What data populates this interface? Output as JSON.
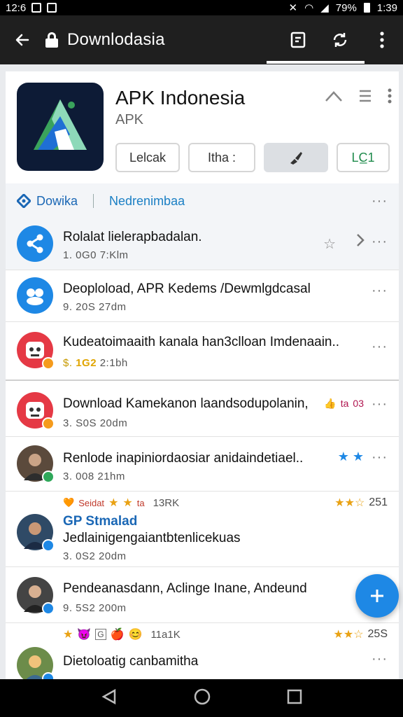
{
  "status_bar": {
    "time_left": "12:6",
    "battery": "79%",
    "clock": "1:39"
  },
  "toolbar": {
    "title": "Downlodasia",
    "icons": [
      "back-arrow-icon",
      "lock-icon",
      "bookmark-icon",
      "refresh-icon",
      "more-vert-icon"
    ]
  },
  "app": {
    "name": "APK Indonesia",
    "subtitle": "APK",
    "buttons": [
      "Lelcak",
      "Ithа :",
      "",
      "LC̲1"
    ]
  },
  "tabs": {
    "tab1": "Dowika",
    "tab2": "Nedrenimbaa"
  },
  "rows": [
    {
      "title": "Rolalat lielerapbadalan.",
      "meta": "1. 0G0 7:Klm",
      "avatar_color": "#1e88e5",
      "icon": "share-icon"
    },
    {
      "title": "Deoploload, APR Kedems /Dewmlgdcasal",
      "meta": "9. 20S 27dm",
      "avatar_color": "#1e88e5",
      "icon": "people-icon"
    },
    {
      "title": "Kudeatoimaaith kanala han3clloan Imdenaain..",
      "meta_prefix": "$.",
      "meta_highlight": "1G2",
      "meta_rest": "2:1bh",
      "avatar_color": "#e53945",
      "icon": "robot-icon"
    },
    {
      "title": "Download Kamekanon laandsodupolanin,",
      "meta": "3. S0S 20dm",
      "avatar_color": "#e53945",
      "icon": "robot-icon",
      "tags": [
        "👍",
        "ta",
        "03"
      ]
    },
    {
      "title": "Renlode inapiniordaosiar anidaindetiael..",
      "meta": "3. 008 21hm",
      "avatar_color": "#5b4a3c",
      "icon": "person-photo-icon"
    },
    {
      "reactions": [
        "🧡",
        "Seidat",
        "⭐",
        "⭐",
        "ta"
      ],
      "reactions_count": "13RK",
      "rating": "251",
      "title_blue": "GP Stmalad",
      "title": "Jedlainigengaiantbtenlicekuas",
      "meta": "3. 0S2 20dm",
      "avatar_color": "#2f4a66",
      "icon": "person-photo-icon"
    },
    {
      "title": "Pendeanasdann, Aclinge Inane, Andeund",
      "meta": "9. 5S2 200m",
      "avatar_color": "#444",
      "icon": "person-photo-icon"
    },
    {
      "reactions": [
        "⭐",
        "😈",
        "G",
        "🍎",
        "😊"
      ],
      "reactions_count": "11a1K",
      "rating": "25S",
      "title": "Dietoloatig canbamitha",
      "meta": "",
      "avatar_color": "#6c8c4a",
      "icon": "person-photo-icon"
    }
  ],
  "fab": {
    "icon": "plus-icon"
  },
  "navbar": {
    "icons": [
      "back-triangle-icon",
      "home-circle-icon",
      "recents-square-icon"
    ]
  },
  "colors": {
    "accent": "#1e88e5",
    "toolbar_bg": "#1f1f1f",
    "star": "#e9a214"
  }
}
